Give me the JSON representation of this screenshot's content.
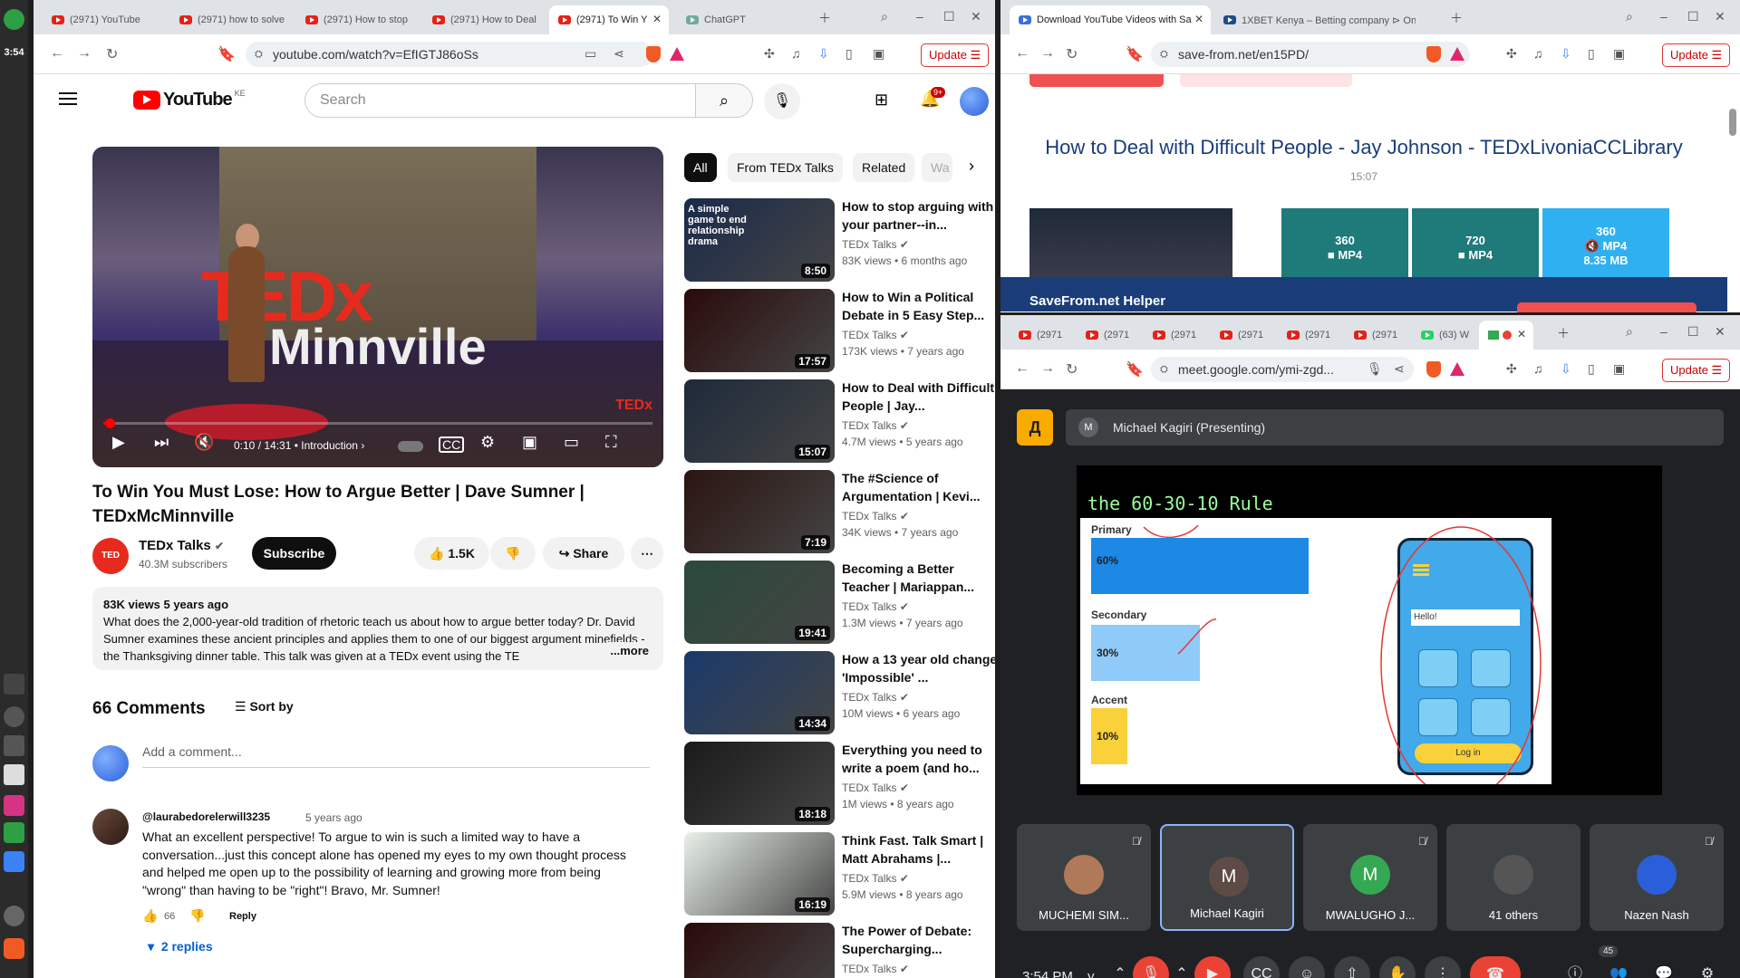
{
  "taskbar": {
    "clock": "3:54"
  },
  "left_browser": {
    "tabs": [
      {
        "label": "(2971) YouTube"
      },
      {
        "label": "(2971) how to solve"
      },
      {
        "label": "(2971) How to stop"
      },
      {
        "label": "(2971) How to Deal"
      },
      {
        "label": "(2971) To Win Y"
      },
      {
        "label": "ChatGPT"
      }
    ],
    "url": "youtube.com/watch?v=EfIGTJ86oSs",
    "update_label": "Update"
  },
  "youtube": {
    "logo": "YouTube",
    "country": "KE",
    "search_placeholder": "Search",
    "notif_count": "9+",
    "player": {
      "time": "0:10 / 14:31",
      "chapter": "Introduction",
      "progress_fraction": 0.011,
      "brand_text": "TEDx",
      "city_text": "Minnville",
      "watermark": "TEDx"
    },
    "title": "To Win You Must Lose: How to Argue Better | Dave Sumner | TEDxMcMinnville",
    "channel": {
      "name": "TEDx Talks",
      "subs": "40.3M subscribers",
      "avatar_text": "TED"
    },
    "subscribe": "Subscribe",
    "likes": "1.5K",
    "share": "Share",
    "description": {
      "meta": "83K views  5 years ago",
      "text": "What does the 2,000-year-old tradition of rhetoric teach us about how to argue better today?  Dr. David Sumner examines these ancient principles and applies them to one of our biggest argument minefields - the Thanksgiving dinner table.  This talk was given at a TEDx event using the TE",
      "more": "...more"
    },
    "comments": {
      "heading": "66 Comments",
      "sort": "Sort by",
      "add_placeholder": "Add a comment...",
      "items": [
        {
          "author": "@laurabedorelerwill3235",
          "time": "5 years ago",
          "text": "What an excellent perspective!  To argue to win is such a limited way to have a conversation...just this concept alone has opened my eyes to my own thought process and helped me open up to the possibility of learning and growing more from being \"wrong\" than having to be \"right\"!  Bravo, Mr. Sumner!",
          "likes": "66",
          "reply": "Reply",
          "replies": "2 replies"
        }
      ]
    },
    "chips": [
      "All",
      "From TEDx Talks",
      "Related",
      "Wa"
    ],
    "recommendations": [
      {
        "title": "How to stop arguing with your partner--in...",
        "channel": "TEDx Talks",
        "meta": "83K views  •  6 months ago",
        "duration": "8:50",
        "thumb_text": "A simple game to end relationship drama"
      },
      {
        "title": "How to Win a Political Debate in 5 Easy Step...",
        "channel": "TEDx Talks",
        "meta": "173K views  •  7 years ago",
        "duration": "17:57",
        "thumb_text": ""
      },
      {
        "title": "How to Deal with Difficult People | Jay...",
        "channel": "TEDx Talks",
        "meta": "4.7M views  •  5 years ago",
        "duration": "15:07",
        "thumb_text": ""
      },
      {
        "title": "The #Science of Argumentation | Kevi...",
        "channel": "TEDx Talks",
        "meta": "34K views  •  7 years ago",
        "duration": "7:19",
        "thumb_text": ""
      },
      {
        "title": "Becoming a Better Teacher | Mariappan...",
        "channel": "TEDx Talks",
        "meta": "1.3M views  •  7 years ago",
        "duration": "19:41",
        "thumb_text": ""
      },
      {
        "title": "How a 13 year old changed 'Impossible' ...",
        "channel": "TEDx Talks",
        "meta": "10M views  •  6 years ago",
        "duration": "14:34",
        "thumb_text": ""
      },
      {
        "title": "Everything you need to write a poem (and ho...",
        "channel": "TEDx Talks",
        "meta": "1M views  •  8 years ago",
        "duration": "18:18",
        "thumb_text": ""
      },
      {
        "title": "Think Fast. Talk Smart | Matt Abrahams |...",
        "channel": "TEDx Talks",
        "meta": "5.9M views  •  8 years ago",
        "duration": "16:19",
        "thumb_text": ""
      },
      {
        "title": "The Power of Debate: Supercharging...",
        "channel": "TEDx Talks",
        "meta": "",
        "duration": "",
        "thumb_text": ""
      }
    ]
  },
  "right_top_browser": {
    "tabs": [
      {
        "label": "Download YouTube Videos with Sa"
      },
      {
        "label": "1XBET Kenya – Betting company ⊳ Onli"
      }
    ],
    "url": "save-from.net/en15PD/",
    "update_label": "Update",
    "page": {
      "title": "How to Deal with Difficult People - Jay Johnson - TEDxLivoniaCCLibrary",
      "duration": "15:07",
      "buttons": [
        {
          "res": "360",
          "fmt": "MP4",
          "size": ""
        },
        {
          "res": "720",
          "fmt": "MP4",
          "size": ""
        },
        {
          "res": "360",
          "fmt": "MP4",
          "size": "8.35 MB"
        }
      ],
      "helper": "SaveFrom.net Helper"
    }
  },
  "right_bottom_browser": {
    "tabs": [
      "(2971",
      "(2971",
      "(2971",
      "(2971",
      "(2971",
      "(2971",
      "(63) W"
    ],
    "url": "meet.google.com/ymi-zgd...",
    "update_label": "Update",
    "meet": {
      "presenter": "Michael Kagiri (Presenting)",
      "presenter_initial": "M",
      "slide": {
        "title": "the 60-30-10 Rule",
        "primary_label": "Primary",
        "primary_value": "60%",
        "secondary_label": "Secondary",
        "secondary_value": "30%",
        "accent_label": "Accent",
        "accent_value": "10%",
        "phone_hello": "Hello!",
        "phone_login": "Log in"
      },
      "participants": [
        {
          "name": "MUCHEMI SIM...",
          "initial": "",
          "color": "#b07a5a",
          "muted": true
        },
        {
          "name": "Michael Kagiri",
          "initial": "M",
          "color": "#5f4b45",
          "muted": false
        },
        {
          "name": "MWALUGHO J...",
          "initial": "M",
          "color": "#34a853",
          "muted": true
        },
        {
          "name": "41 others",
          "initial": "",
          "color": "#555",
          "muted": false
        },
        {
          "name": "Nazen Nash",
          "initial": "",
          "color": "#2b5fd9",
          "muted": true
        }
      ],
      "clock": "3:54 PM",
      "code_prefix": "y.",
      "people_count": "45"
    }
  }
}
